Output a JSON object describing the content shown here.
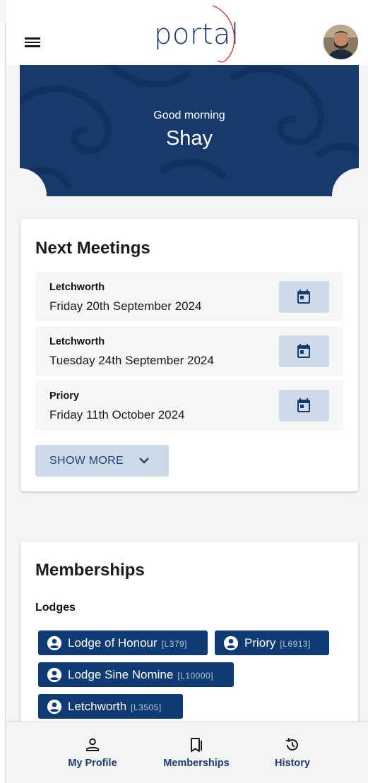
{
  "header": {
    "logo_text": "portal",
    "menu_icon": "menu-icon",
    "avatar": "user-avatar"
  },
  "hero": {
    "greeting": "Good morning",
    "name": "Shay"
  },
  "meetings": {
    "title": "Next Meetings",
    "items": [
      {
        "lodge": "Letchworth",
        "date": "Friday 20th September 2024",
        "icon": "calendar-icon"
      },
      {
        "lodge": "Letchworth",
        "date": "Tuesday 24th September 2024",
        "icon": "calendar-icon"
      },
      {
        "lodge": "Priory",
        "date": "Friday 11th October 2024",
        "icon": "calendar-icon"
      }
    ],
    "show_more": "SHOW MORE"
  },
  "memberships": {
    "title": "Memberships",
    "subhead": "Lodges",
    "chips": [
      {
        "name": "Lodge of Honour",
        "code": "[L379]"
      },
      {
        "name": "Priory",
        "code": "[L6913]"
      },
      {
        "name": "Lodge Sine Nomine",
        "code": "[L10000]"
      },
      {
        "name": "Letchworth",
        "code": "[L3505]"
      }
    ]
  },
  "nav": {
    "items": [
      {
        "label": "My Profile",
        "icon": "person-icon"
      },
      {
        "label": "Memberships",
        "icon": "bookmarks-icon"
      },
      {
        "label": "History",
        "icon": "history-icon"
      }
    ]
  },
  "colors": {
    "primary": "#173a6a",
    "chip": "#103a72",
    "button_tint": "#cfdae8",
    "background": "#f4f4f4"
  }
}
